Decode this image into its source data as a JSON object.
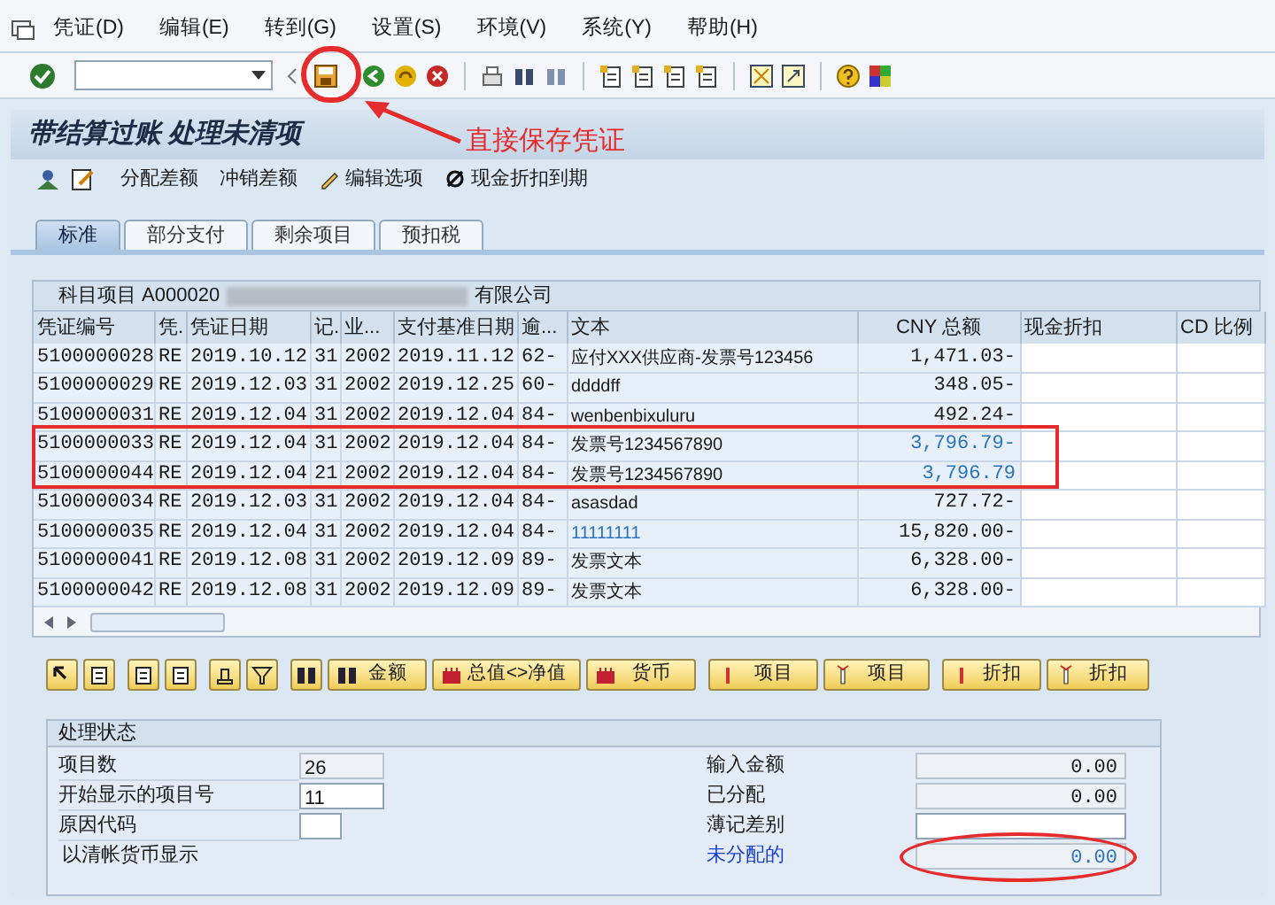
{
  "menu": [
    {
      "label": "凭证(D)"
    },
    {
      "label": "编辑(E)"
    },
    {
      "label": "转到(G)"
    },
    {
      "label": "设置(S)"
    },
    {
      "label": "环境(V)"
    },
    {
      "label": "系统(Y)"
    },
    {
      "label": "帮助(H)"
    }
  ],
  "title": "带结算过账 处理未清项",
  "app_toolbar": [
    {
      "kind": "person"
    },
    {
      "kind": "edit"
    },
    {
      "kind": "text",
      "label": "分配差额"
    },
    {
      "kind": "text",
      "label": "冲销差额"
    },
    {
      "kind": "pencil",
      "label": "编辑选项"
    },
    {
      "kind": "slash",
      "label": "现金折扣到期"
    }
  ],
  "tabs": [
    {
      "label": "标准",
      "selected": true
    },
    {
      "label": "部分支付",
      "selected": false
    },
    {
      "label": "剩余项目",
      "selected": false
    },
    {
      "label": "预扣税",
      "selected": false
    }
  ],
  "table": {
    "caption_prefix": "科目项目 A000020",
    "caption_suffix": "有限公司",
    "columns": [
      "凭证编号",
      "凭.",
      "凭证日期",
      "记.",
      "业...",
      "支付基准日期",
      "逾...",
      "文本",
      "CNY 总额",
      "现金折扣",
      "CD 比例"
    ],
    "rows": [
      {
        "cells": [
          "5100000028",
          "RE",
          "2019.10.12",
          "31",
          "2002",
          "2019.11.12",
          "62-",
          "应付XXX供应商-发票号123456",
          "1,471.03-"
        ],
        "text_blue": false,
        "amount_blue": false
      },
      {
        "cells": [
          "5100000029",
          "RE",
          "2019.12.03",
          "31",
          "2002",
          "2019.12.25",
          "60-",
          "ddddff",
          "348.05-"
        ],
        "text_blue": false,
        "amount_blue": false
      },
      {
        "cells": [
          "5100000031",
          "RE",
          "2019.12.04",
          "31",
          "2002",
          "2019.12.04",
          "84-",
          "wenbenbixuluru",
          "492.24-"
        ],
        "text_blue": false,
        "amount_blue": false
      },
      {
        "cells": [
          "5100000033",
          "RE",
          "2019.12.04",
          "31",
          "2002",
          "2019.12.04",
          "84-",
          "发票号1234567890",
          "3,796.79-"
        ],
        "text_blue": false,
        "amount_blue": true
      },
      {
        "cells": [
          "5100000044",
          "RE",
          "2019.12.04",
          "21",
          "2002",
          "2019.12.04",
          "84-",
          "发票号1234567890",
          "3,796.79"
        ],
        "text_blue": false,
        "amount_blue": true
      },
      {
        "cells": [
          "5100000034",
          "RE",
          "2019.12.03",
          "31",
          "2002",
          "2019.12.04",
          "84-",
          "asasdad",
          "727.72-"
        ],
        "text_blue": false,
        "amount_blue": false
      },
      {
        "cells": [
          "5100000035",
          "RE",
          "2019.12.04",
          "31",
          "2002",
          "2019.12.04",
          "84-",
          "11111111",
          "15,820.00-"
        ],
        "text_blue": true,
        "amount_blue": false
      },
      {
        "cells": [
          "5100000041",
          "RE",
          "2019.12.08",
          "31",
          "2002",
          "2019.12.09",
          "89-",
          "发票文本",
          "6,328.00-"
        ],
        "text_blue": false,
        "amount_blue": false
      },
      {
        "cells": [
          "5100000042",
          "RE",
          "2019.12.08",
          "31",
          "2002",
          "2019.12.09",
          "89-",
          "发票文本",
          "6,328.00-"
        ],
        "text_blue": false,
        "amount_blue": false
      }
    ]
  },
  "buttons": [
    {
      "kind": "icon"
    },
    {
      "kind": "icon"
    },
    {
      "kind": "icon"
    },
    {
      "kind": "icon"
    },
    {
      "kind": "icon"
    },
    {
      "kind": "icon"
    },
    {
      "kind": "icon"
    },
    {
      "kind": "labeled",
      "label": "金额"
    },
    {
      "kind": "labeled",
      "label": "总值<>净值"
    },
    {
      "kind": "labeled",
      "label": "货币"
    },
    {
      "kind": "labeled",
      "label": "项目"
    },
    {
      "kind": "labeled",
      "label": "项目"
    },
    {
      "kind": "labeled",
      "label": "折扣"
    },
    {
      "kind": "labeled",
      "label": "折扣"
    }
  ],
  "status": {
    "title": "处理状态",
    "left": [
      {
        "label": "项目数",
        "value": "26",
        "editable": false
      },
      {
        "label": "开始显示的项目号",
        "value": "11",
        "editable": true
      },
      {
        "label": "原因代码",
        "editable": true
      }
    ],
    "display_option": "以清帐货币显示",
    "right": [
      {
        "label": "输入金额",
        "value": "0.00",
        "link": false,
        "editable": false
      },
      {
        "label": "已分配",
        "value": "0.00",
        "link": false,
        "editable": false
      },
      {
        "label": "薄记差别",
        "link": false,
        "editable": true
      },
      {
        "label": "未分配的",
        "value": "0.00",
        "link": true,
        "editable": false
      }
    ]
  },
  "annotation": {
    "callout": "直接保存凭证"
  }
}
